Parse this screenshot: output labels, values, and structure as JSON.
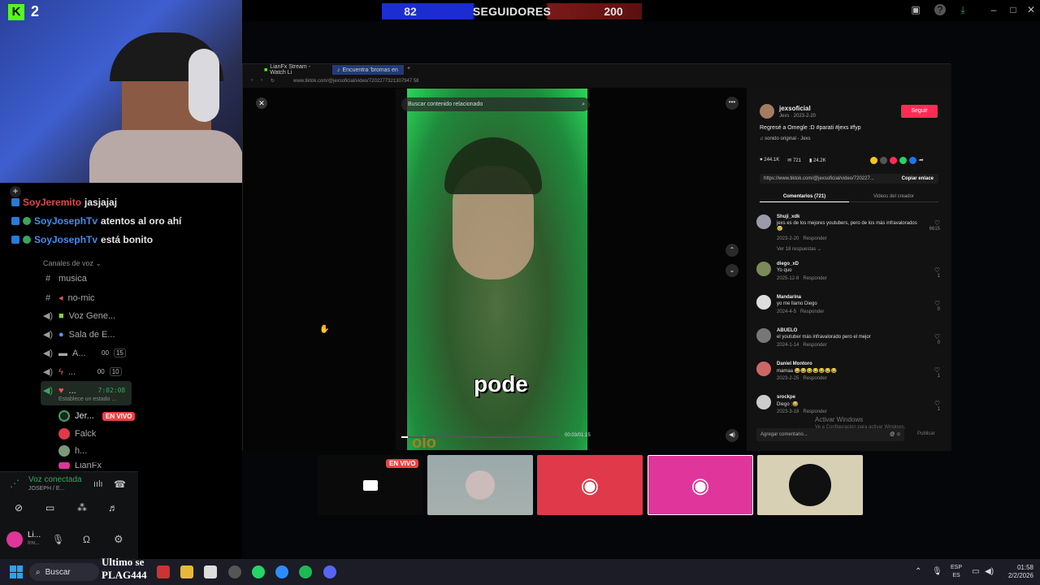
{
  "overlay": {
    "kick_count": "2",
    "followers_left": "82",
    "followers_label": "SEGUIDORES",
    "followers_right": "200"
  },
  "chat": [
    {
      "user": "SoyJeremito",
      "message": "jasjajaj",
      "color": "red"
    },
    {
      "user": "SoyJosephTv",
      "message": "atentos al oro ahí",
      "color": "blue"
    },
    {
      "user": "SoyJosephTv",
      "message": "está bonito",
      "color": "blue"
    }
  ],
  "discord": {
    "section_voice": "Canales de voz",
    "channels": [
      {
        "icon": "#",
        "label": "musica"
      },
      {
        "icon": "#",
        "label": "no-mic"
      },
      {
        "icon": "speaker",
        "label": "Voz Gene..."
      },
      {
        "icon": "speaker",
        "label": "Sala de E..."
      },
      {
        "icon": "speaker",
        "label": "A...",
        "b1": "00",
        "b2": "15"
      },
      {
        "icon": "speaker",
        "label": "...",
        "b1": "00",
        "b2": "10"
      },
      {
        "icon": "speaker",
        "label": "...",
        "timer": "7:02:08"
      }
    ],
    "status_hint": "Establece un estado ...",
    "members": [
      {
        "name": "Jer...",
        "live": "EN VIVO"
      },
      {
        "name": "Falck"
      },
      {
        "name": "h..."
      },
      {
        "name": "LianFx"
      }
    ],
    "voice_connected": "Voz conectada",
    "voice_sub": "JOSEPH / E...",
    "user_name": "Li...",
    "user_sub": "Inv..."
  },
  "browser": {
    "tabs": [
      "LianFx Stream - Watch Li",
      "Encuentra 'bromas en"
    ],
    "url": "www.tiktok.com/@jexsoficial/video/7202277321307947 58",
    "search_placeholder": "Buscar contenido relacionado",
    "caption": "pode",
    "bottom_text": "olo",
    "time": "00:03/01:15"
  },
  "tiktok": {
    "author": "jexsoficial",
    "author_sub": "Jexs · 2023-2-20",
    "follow_label": "Seguir",
    "description": "Regresé a Omegle :D #parati #jexs #fyp",
    "sound": "sonido original - Jexs",
    "likes": "244.1K",
    "comments_count": "721",
    "saves": "24.2K",
    "link": "https://www.tiktok.com/@jexsoficial/video/720227...",
    "copy_label": "Copiar enlace",
    "tab_comments": "Comentarios (721)",
    "tab_creator": "Videos del creador",
    "comments": [
      {
        "name": "Shuji_xdk",
        "text": "jexs es de los mejores youtubers, pero de los más infravalorados 😢",
        "date": "2023-2-20",
        "reply": "Responder",
        "likes": "6615",
        "more": "Ver 18 respuestas"
      },
      {
        "name": "diego_xD",
        "text": "Yo quo",
        "date": "2025-12-8",
        "reply": "Responder",
        "likes": "1"
      },
      {
        "name": "Mandarina",
        "text": "yo me llamo Diego",
        "date": "2024-4-5",
        "reply": "Responder",
        "likes": "0"
      },
      {
        "name": "ABUELO",
        "text": "el youtuber más infravalorado pero el mejor",
        "date": "2024-1-14",
        "reply": "Responder",
        "likes": "0"
      },
      {
        "name": "Daniel Montoro",
        "text": "mamaa 😂😂😂😂😂😂😂",
        "date": "2023-2-25",
        "reply": "Responder",
        "likes": "1"
      },
      {
        "name": "srockpe",
        "text": "Diego :😂",
        "date": "2023-3-18",
        "reply": "Responder",
        "likes": "1"
      }
    ],
    "comment_placeholder": "Agregar comentario...",
    "publish_label": "Publicar",
    "watermark1": "Activar Windows",
    "watermark2": "Ve a Configuración para activar Windows."
  },
  "thumbnails": {
    "live_badge": "EN VIVO"
  },
  "taskbar": {
    "search_label": "Buscar",
    "overlay_text1": "Ultimo se",
    "overlay_text2": "PLAG444",
    "lang1": "ESP",
    "lang2": "ES",
    "time": "01:58",
    "date": "2/2/2026"
  },
  "colors": {
    "follow_btn": "#fe2c55",
    "discord_blurple": "#5865f2",
    "discord_red": "#e0394a",
    "discord_pink": "#e0359a",
    "live_red": "#ed4245"
  }
}
